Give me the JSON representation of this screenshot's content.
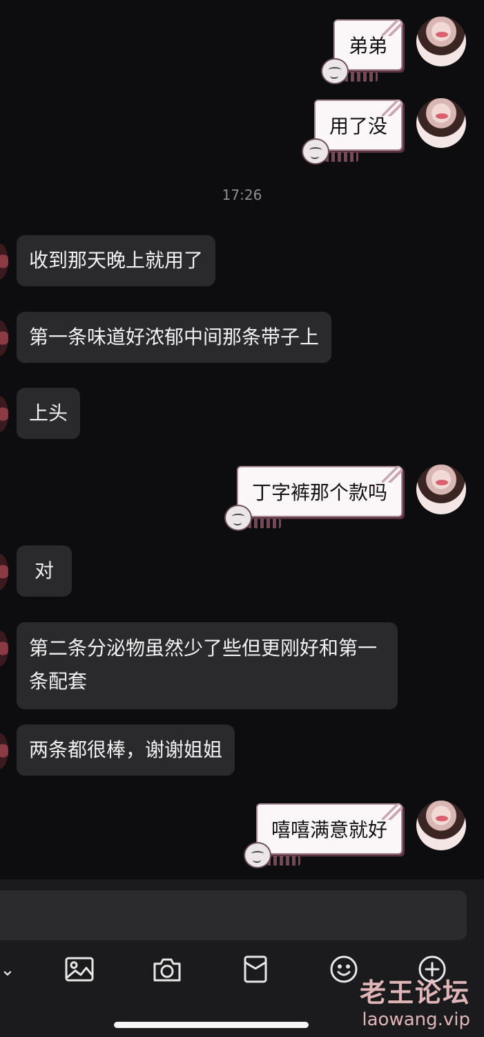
{
  "chat": {
    "messages": [
      {
        "from": "self",
        "text": "弟弟"
      },
      {
        "from": "self",
        "text": "用了没"
      },
      {
        "from": "other",
        "text": "收到那天晚上就用了"
      },
      {
        "from": "other",
        "text": "第一条味道好浓郁中间那条带子上"
      },
      {
        "from": "other",
        "text": "上头"
      },
      {
        "from": "self",
        "text": "丁字裤那个款吗"
      },
      {
        "from": "other",
        "text": "对"
      },
      {
        "from": "other",
        "text": "第二条分泌物虽然少了些但更刚好和第一条配套"
      },
      {
        "from": "other",
        "text": "两条都很棒，谢谢姐姐"
      },
      {
        "from": "self",
        "text": "嘻嘻满意就好"
      }
    ],
    "timestamp": "17:26"
  },
  "input": {
    "placeholder": ""
  },
  "toolbar": {
    "icons": [
      "image-icon",
      "camera-icon",
      "red-packet-icon",
      "emoji-icon",
      "plus-icon"
    ]
  },
  "watermark": {
    "title": "老王论坛",
    "url": "laowang.vip"
  },
  "colors": {
    "background": "#0d0d0f",
    "incoming_bubble": "#2a2a2d",
    "outgoing_bubble": "#fbf7f8",
    "timestamp": "#8e8e93",
    "watermark": "#f1c3c6"
  }
}
